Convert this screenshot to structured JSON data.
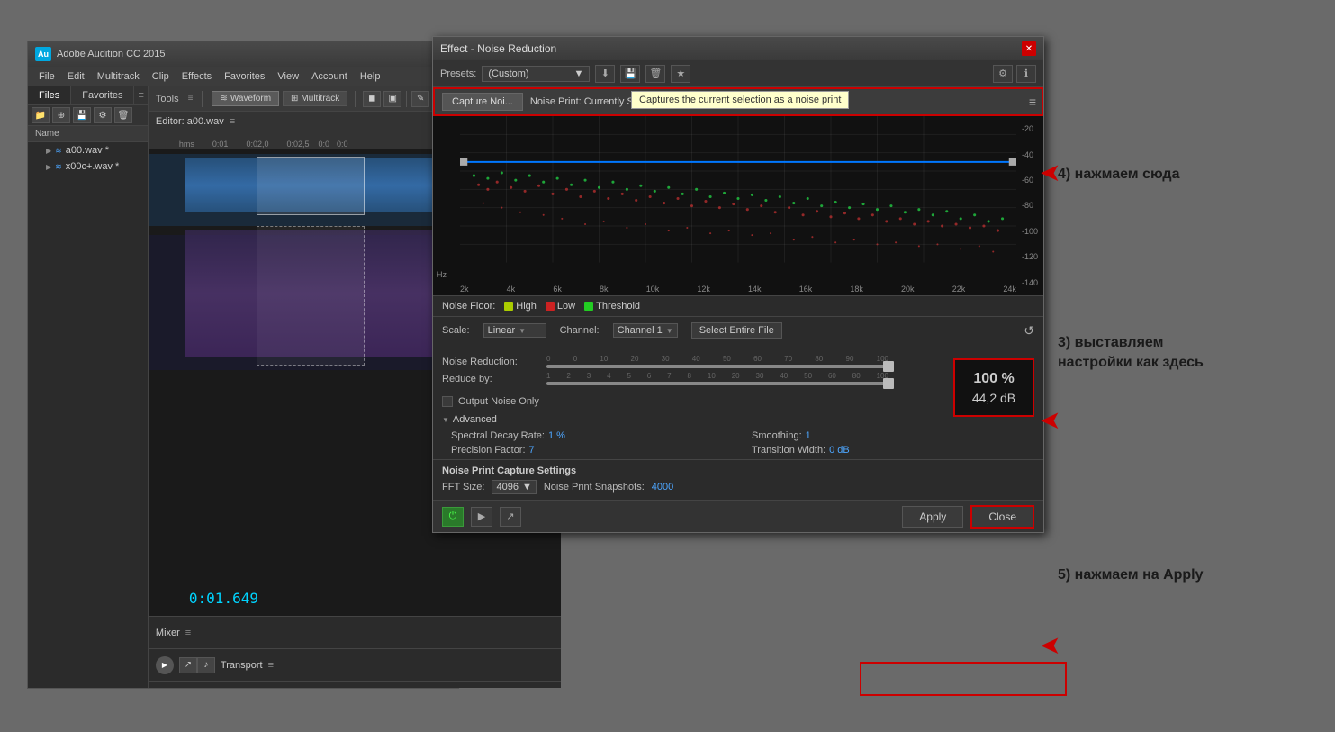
{
  "audition": {
    "title": "Adobe Audition CC 2015",
    "logo": "Au",
    "menu": [
      "File",
      "Edit",
      "Multitrack",
      "Clip",
      "Effects",
      "Favorites",
      "View",
      "Account",
      "Help"
    ],
    "files_panel": {
      "tabs": [
        "Files",
        "Favorites"
      ],
      "col_header": "Name",
      "files": [
        {
          "name": "a00.wav *",
          "type": "wave"
        },
        {
          "name": "x00c+.wav *",
          "type": "wave"
        }
      ]
    },
    "tools": [
      "Waveform",
      "Multitrack"
    ],
    "editor_label": "Editor: a00.wav",
    "time_display": "0:01.649",
    "ruler_marks": [
      "0:01",
      "0:02,0",
      "0:02,5",
      "0:0",
      "0:0"
    ],
    "bottom": {
      "mixer": "Mixer",
      "transport": "Transport"
    }
  },
  "dialog": {
    "title": "Effect - Noise Reduction",
    "presets_label": "Presets:",
    "presets_value": "(Custom)",
    "tooltip": "Captures the current selection as a noise print",
    "noise_print_label": "Noise Print: Currently Set Noise Print",
    "capture_btn": "Capture Noi...",
    "legend": {
      "label": "Noise Floor:",
      "items": [
        {
          "color": "#aacc00",
          "label": "High"
        },
        {
          "color": "#cc2222",
          "label": "Low"
        },
        {
          "color": "#22cc22",
          "label": "Threshold"
        }
      ]
    },
    "scale_label": "Scale:",
    "scale_value": "Linear",
    "channel_label": "Channel:",
    "channel_value": "Channel 1",
    "select_entire_btn": "Select Entire File",
    "noise_reduction_label": "Noise Reduction:",
    "reduce_by_label": "Reduce by:",
    "value_percent": "100 %",
    "value_db": "44,2 dB",
    "output_noise_label": "Output Noise Only",
    "advanced_label": "Advanced",
    "spectral_decay_label": "Spectral Decay Rate:",
    "spectral_decay_value": "1 %",
    "smoothing_label": "Smoothing:",
    "smoothing_value": "1",
    "precision_label": "Precision Factor:",
    "precision_value": "7",
    "transition_label": "Transition Width:",
    "transition_value": "0 dB",
    "noise_print_section": "Noise Print Capture Settings",
    "fft_label": "FFT Size:",
    "fft_value": "4096",
    "snapshots_label": "Noise Print Snapshots:",
    "snapshots_value": "4000",
    "apply_btn": "Apply",
    "close_btn": "Close",
    "freq_labels": [
      "Hz",
      "2k",
      "4k",
      "6k",
      "8k",
      "10k",
      "12k",
      "14k",
      "16k",
      "18k",
      "20k",
      "22k",
      "24k"
    ],
    "db_labels": [
      "-20",
      "-40",
      "-60",
      "-80",
      "-100",
      "-120",
      "-140"
    ]
  },
  "annotations": {
    "step4": "4) нажмаем сюда",
    "step3": "3) выставляем\nнастройки как здесь",
    "step5": "5) нажмаем на Apply"
  },
  "icons": {
    "close": "✕",
    "dropdown_arrow": "▼",
    "reset": "↺",
    "play": "▶",
    "power": "⏻",
    "export": "↗",
    "settings": "≡"
  }
}
